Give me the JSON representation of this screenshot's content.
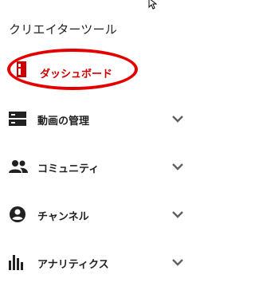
{
  "sidebar": {
    "title": "クリエイターツール",
    "items": [
      {
        "label": "ダッシュボード",
        "icon": "dashboard-icon",
        "active": true
      },
      {
        "label": "動画の管理",
        "icon": "video-manager-icon",
        "expandable": true
      },
      {
        "label": "コミュニティ",
        "icon": "community-icon",
        "expandable": true
      },
      {
        "label": "チャンネル",
        "icon": "channel-icon",
        "expandable": true
      },
      {
        "label": "アナリティクス",
        "icon": "analytics-icon",
        "expandable": true
      }
    ]
  },
  "annotation": {
    "highlight": "red-ellipse"
  },
  "colors": {
    "active": "#cc0000",
    "highlight": "#e50000",
    "icon": "#212121",
    "chevron": "#606060"
  }
}
